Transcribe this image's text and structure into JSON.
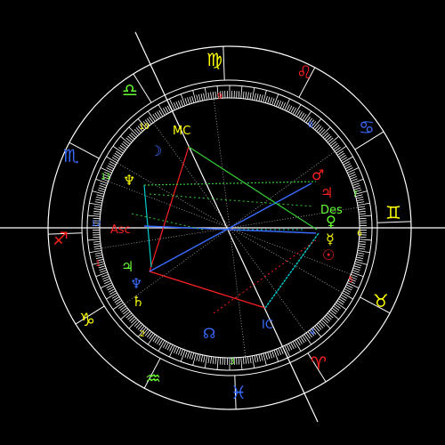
{
  "signs": [
    {
      "name": "virgo",
      "glyph": "♍",
      "color": "#ffff00"
    },
    {
      "name": "leo",
      "glyph": "♌",
      "color": "#ff2020"
    },
    {
      "name": "cancer",
      "glyph": "♋",
      "color": "#3a6bff"
    },
    {
      "name": "gemini",
      "glyph": "♊",
      "color": "#ffff00"
    },
    {
      "name": "taurus",
      "glyph": "♉",
      "color": "#ffff00"
    },
    {
      "name": "aries",
      "glyph": "♈",
      "color": "#ff2020"
    },
    {
      "name": "pisces",
      "glyph": "♓",
      "color": "#3a6bff"
    },
    {
      "name": "aquarius",
      "glyph": "♒",
      "color": "#66ff33"
    },
    {
      "name": "capricorn",
      "glyph": "♑",
      "color": "#ffff00"
    },
    {
      "name": "sagittarius",
      "glyph": "♐",
      "color": "#ff2020"
    },
    {
      "name": "scorpio",
      "glyph": "♏",
      "color": "#3a6bff"
    },
    {
      "name": "libra",
      "glyph": "♎",
      "color": "#66ff33"
    }
  ],
  "houses": [
    {
      "num": "1",
      "color": "#ff2020"
    },
    {
      "num": "2",
      "color": "#ffff00"
    },
    {
      "num": "3",
      "color": "#66ff33"
    },
    {
      "num": "4",
      "color": "#3a6bff"
    },
    {
      "num": "5",
      "color": "#ff2020"
    },
    {
      "num": "6",
      "color": "#ffff00"
    },
    {
      "num": "7",
      "color": "#66ff33"
    },
    {
      "num": "8",
      "color": "#3a6bff"
    },
    {
      "num": "9",
      "color": "#ff2020"
    },
    {
      "num": "10",
      "color": "#ffff00"
    },
    {
      "num": "11",
      "color": "#66ff33"
    },
    {
      "num": "12",
      "color": "#3a6bff"
    }
  ],
  "angles": {
    "asc": "Asc",
    "mc": "MC",
    "des": "Des",
    "ic": "IC"
  },
  "planets": [
    {
      "name": "moon",
      "glyph": "☽",
      "color": "#3a6bff"
    },
    {
      "name": "neptune-top",
      "glyph": "♆",
      "color": "#ffff00"
    },
    {
      "name": "mars",
      "glyph": "♂",
      "color": "#ff2020"
    },
    {
      "name": "jupiter",
      "glyph": "♃",
      "color": "#ff2020"
    },
    {
      "name": "sun",
      "glyph": "☉",
      "color": "#ff2020"
    },
    {
      "name": "venus",
      "glyph": "♀",
      "color": "#66ff33"
    },
    {
      "name": "mercury",
      "glyph": "☿",
      "color": "#ffff00"
    },
    {
      "name": "saturn-left",
      "glyph": "♃",
      "color": "#66ff33"
    },
    {
      "name": "neptune-low",
      "glyph": "♆",
      "color": "#3a6bff"
    },
    {
      "name": "saturn",
      "glyph": "♄",
      "color": "#ffff00"
    },
    {
      "name": "node",
      "glyph": "☊",
      "color": "#3a6bff"
    }
  ]
}
